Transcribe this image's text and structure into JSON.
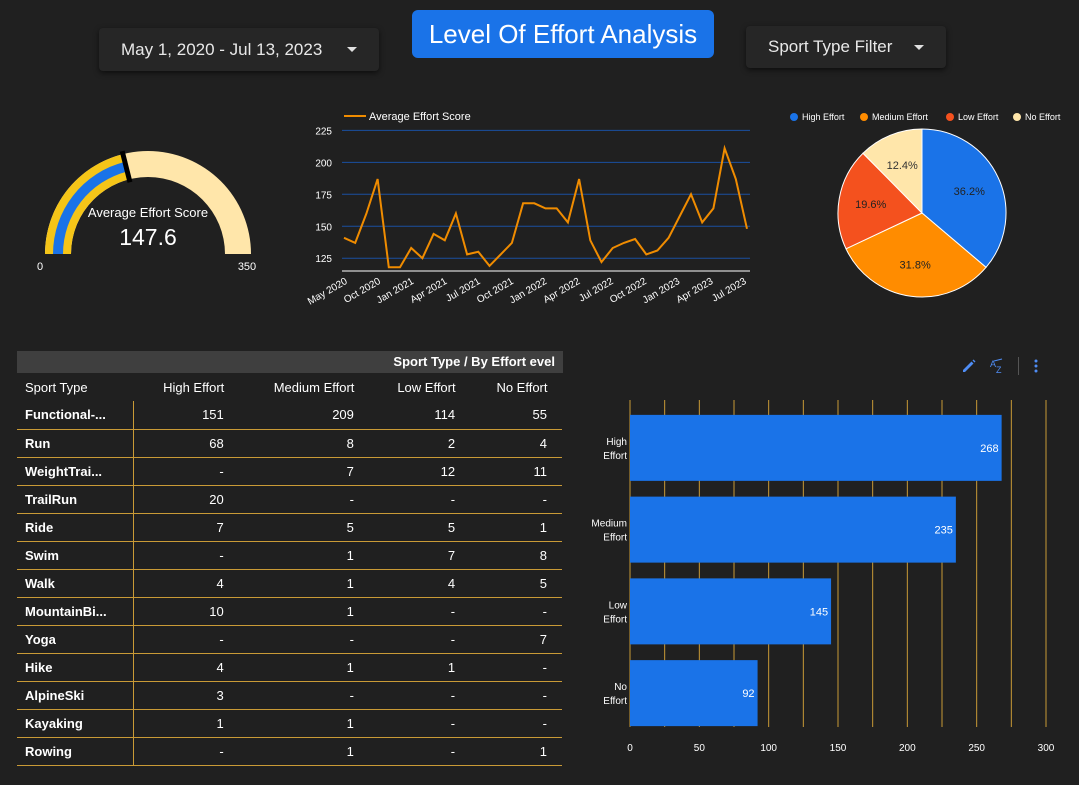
{
  "header": {
    "title": "Level Of Effort Analysis",
    "date_range": "May 1, 2020 - Jul 13, 2023",
    "sport_filter": "Sport Type Filter"
  },
  "gauge": {
    "label": "Average Effort Score",
    "value": 147.6,
    "display_value": "147.6",
    "min": 0,
    "max": 350,
    "min_label": "0",
    "max_label": "350",
    "colors": {
      "track": "#ffe6aa",
      "fill": "#f5c518",
      "inner": "#1a73e8",
      "target": "#000000"
    }
  },
  "line_chart": {
    "chart_data": {
      "type": "line",
      "legend": "top-left",
      "series": [
        {
          "name": "Average Effort Score",
          "color": "#f08c00"
        }
      ],
      "ylim": [
        115,
        230
      ],
      "yticks": [
        125,
        150,
        175,
        200,
        225
      ],
      "ytick_labels": [
        "125",
        "150",
        "175",
        "200",
        "225"
      ],
      "xtick_labels": [
        "May 2020",
        "Oct 2020",
        "Jan 2021",
        "Apr 2021",
        "Jul 2021",
        "Oct 2021",
        "Jan 2022",
        "Apr 2022",
        "Jul 2022",
        "Oct 2022",
        "Jan 2023",
        "Apr 2023",
        "Jul 2023"
      ],
      "values": [
        141,
        137,
        160,
        187,
        118,
        118,
        133,
        125,
        144,
        139,
        160,
        128,
        130,
        119,
        128,
        137,
        168,
        168,
        164,
        164,
        153,
        187,
        139,
        122,
        133,
        137,
        140,
        128,
        131,
        141,
        158,
        175,
        153,
        164,
        211,
        187,
        148
      ],
      "gridlines": "horizontal",
      "grid_color": "#1a4fa0"
    }
  },
  "pie_chart": {
    "chart_data": {
      "type": "pie",
      "legend": "top",
      "labels": [
        "High Effort",
        "Medium Effort",
        "Low Effort",
        "No Effort"
      ],
      "values": [
        36.2,
        31.8,
        19.6,
        12.4
      ],
      "display_values": [
        "36.2%",
        "31.8%",
        "19.6%",
        "12.4%"
      ],
      "colors": [
        "#1a73e8",
        "#ff8c00",
        "#f4511e",
        "#ffe6aa"
      ]
    }
  },
  "table": {
    "header_title": "Sport Type / By Effort evel",
    "columns": [
      "Sport Type",
      "High Effort",
      "Medium Effort",
      "Low Effort",
      "No Effort"
    ],
    "rows": [
      [
        "Functional-...",
        "151",
        "209",
        "114",
        "55"
      ],
      [
        "Run",
        "68",
        "8",
        "2",
        "4"
      ],
      [
        "WeightTrai...",
        "-",
        "7",
        "12",
        "11"
      ],
      [
        "TrailRun",
        "20",
        "-",
        "-",
        "-"
      ],
      [
        "Ride",
        "7",
        "5",
        "5",
        "1"
      ],
      [
        "Swim",
        "-",
        "1",
        "7",
        "8"
      ],
      [
        "Walk",
        "4",
        "1",
        "4",
        "5"
      ],
      [
        "MountainBi...",
        "10",
        "1",
        "-",
        "-"
      ],
      [
        "Yoga",
        "-",
        "-",
        "-",
        "7"
      ],
      [
        "Hike",
        "4",
        "1",
        "1",
        "-"
      ],
      [
        "AlpineSki",
        "3",
        "-",
        "-",
        "-"
      ],
      [
        "Kayaking",
        "1",
        "1",
        "-",
        "-"
      ],
      [
        "Rowing",
        "-",
        "1",
        "-",
        "1"
      ]
    ]
  },
  "bar_chart": {
    "chart_data": {
      "type": "bar",
      "orientation": "horizontal",
      "categories": [
        [
          "High",
          "Effort"
        ],
        [
          "Medium",
          "Effort"
        ],
        [
          "Low",
          "Effort"
        ],
        [
          "No",
          "Effort"
        ]
      ],
      "values": [
        268,
        235,
        145,
        92
      ],
      "value_labels": [
        "268",
        "235",
        "145",
        "92"
      ],
      "xlim": [
        0,
        300
      ],
      "xticks": [
        0,
        50,
        100,
        150,
        200,
        250,
        300
      ],
      "xtick_labels": [
        "0",
        "50",
        "100",
        "150",
        "200",
        "250",
        "300"
      ],
      "bar_color": "#1a73e8",
      "grid_color": "#c99a36"
    },
    "toolbar": {
      "edit_icon": "pencil-icon",
      "sort_icon": "sort-az-icon",
      "menu_icon": "more-vert-icon"
    }
  }
}
